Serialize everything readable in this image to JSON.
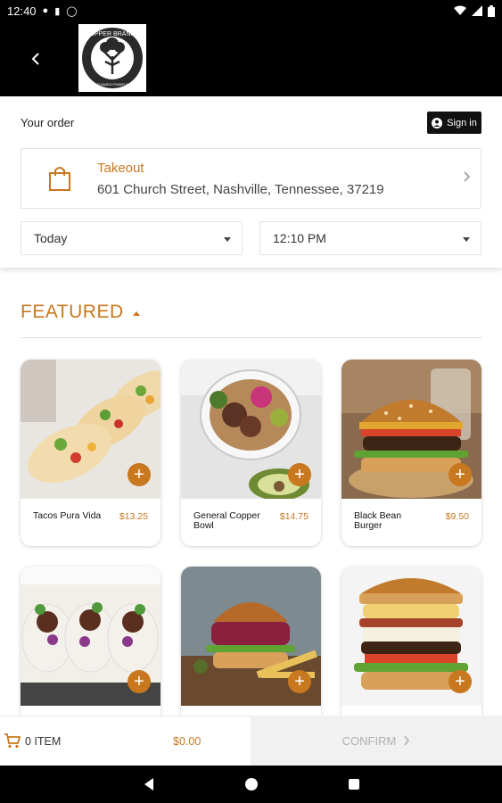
{
  "status": {
    "time": "12:40"
  },
  "header": {
    "back_icon": "chevron-left-icon",
    "logo_text": "COPPER BRANCH",
    "logo_tagline": "PLANT-BASED POWER FOOD"
  },
  "order": {
    "label": "Your order",
    "signin_label": "Sign in",
    "method": "Takeout",
    "address": "601 Church Street, Nashville, Tennessee, 37219",
    "day": "Today",
    "time": "12:10 PM"
  },
  "section": {
    "title": "FEATURED"
  },
  "products": [
    {
      "name": "Tacos Pura Vida",
      "price": "$13.25"
    },
    {
      "name": "General Copper Bowl",
      "price": "$14.75"
    },
    {
      "name": "Black Bean Burger",
      "price": "$9.50"
    },
    {
      "name": "",
      "price": ""
    },
    {
      "name": "",
      "price": ""
    },
    {
      "name": "",
      "price": ""
    }
  ],
  "cart": {
    "items": "0 ITEM",
    "total": "$0.00",
    "confirm_label": "CONFIRM"
  },
  "colors": {
    "accent": "#c8781f",
    "bar": "#000000"
  }
}
